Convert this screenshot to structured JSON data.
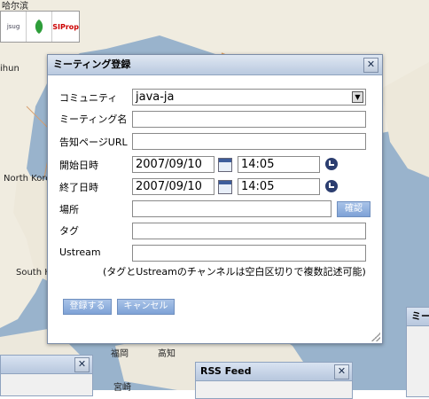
{
  "map": {
    "labels": [
      "哈尔滨",
      "ihun",
      "North Korea",
      "South H",
      "福岡",
      "高知",
      "宮崎"
    ]
  },
  "logos": [
    "jsug",
    "JSUG",
    "SIProp"
  ],
  "dialog": {
    "title": "ミーティング登録",
    "close": "✕",
    "fields": {
      "community_label": "コミュニティ",
      "community_value": "java-ja",
      "meeting_name_label": "ミーティング名",
      "meeting_name_value": "",
      "notice_url_label": "告知ページURL",
      "notice_url_value": "",
      "start_label": "開始日時",
      "start_date": "2007/09/10",
      "start_time": "14:05",
      "end_label": "終了日時",
      "end_date": "2007/09/10",
      "end_time": "14:05",
      "place_label": "場所",
      "place_value": "",
      "confirm_button": "確認",
      "tag_label": "タグ",
      "tag_value": "",
      "ustream_label": "Ustream",
      "ustream_value": ""
    },
    "note": "(タグとUstreamのチャンネルは空白区切りで複数記述可能)",
    "register_button": "登録する",
    "cancel_button": "キャンセル"
  },
  "background_windows": {
    "rss_title": "RSS Feed",
    "right_title": "ミー"
  }
}
